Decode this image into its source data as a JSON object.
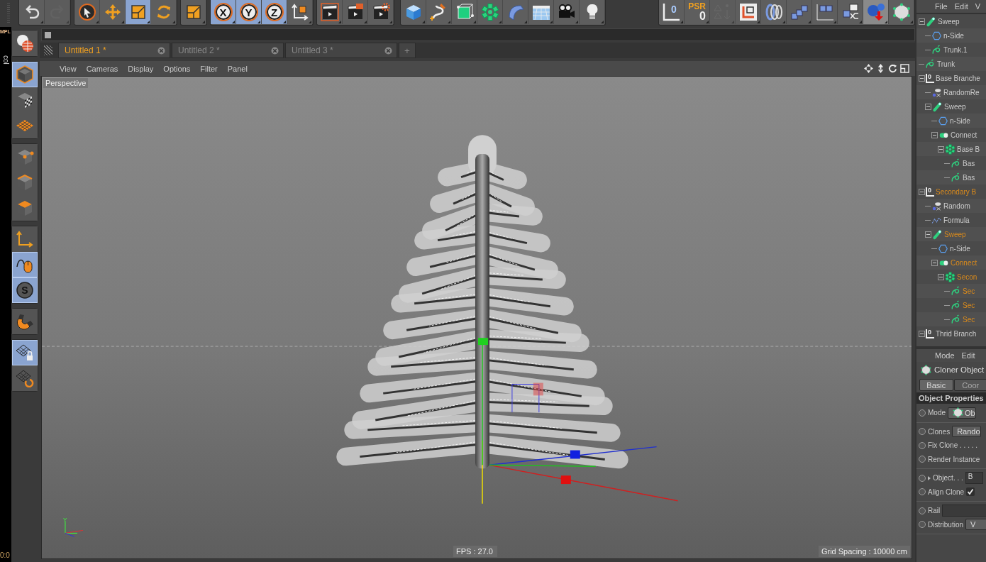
{
  "toolbar": {
    "groups": [
      {
        "buttons": [
          {
            "kind": "undo",
            "selected": false,
            "disabled": false
          },
          {
            "kind": "redo",
            "selected": false,
            "disabled": true
          }
        ]
      },
      {
        "buttons": [
          {
            "kind": "select",
            "selected": false,
            "disabled": false
          },
          {
            "kind": "move",
            "selected": false,
            "disabled": false
          },
          {
            "kind": "scale",
            "selected": true,
            "disabled": false
          },
          {
            "kind": "rotate",
            "selected": false,
            "disabled": false
          }
        ]
      },
      {
        "buttons": [
          {
            "kind": "scale",
            "selected": false,
            "disabled": false
          }
        ]
      },
      {
        "buttons": [
          {
            "kind": "axis-lock",
            "label": "X",
            "selected": true,
            "disabled": false
          },
          {
            "kind": "axis-lock",
            "label": "Y",
            "selected": true,
            "disabled": false
          },
          {
            "kind": "axis-lock",
            "label": "Z",
            "selected": true,
            "disabled": false
          },
          {
            "kind": "coords",
            "selected": false,
            "disabled": false
          }
        ]
      },
      {
        "buttons": [
          {
            "kind": "render-view",
            "selected": false,
            "disabled": false
          },
          {
            "kind": "render-picture",
            "selected": false,
            "disabled": false
          },
          {
            "kind": "render-settings",
            "selected": false,
            "disabled": false
          }
        ]
      },
      {
        "buttons": [
          {
            "kind": "cube",
            "selected": false,
            "disabled": false
          },
          {
            "kind": "pen",
            "selected": false,
            "disabled": false
          },
          {
            "kind": "subdivision",
            "selected": false,
            "disabled": false
          },
          {
            "kind": "cloner",
            "selected": false,
            "disabled": false
          },
          {
            "kind": "deformer",
            "selected": false,
            "disabled": false
          },
          {
            "kind": "floor",
            "selected": false,
            "disabled": false
          },
          {
            "kind": "camera",
            "selected": false,
            "disabled": false
          },
          {
            "kind": "light",
            "selected": false,
            "disabled": false
          }
        ]
      },
      {
        "buttons": [
          {
            "kind": "null",
            "label": "0",
            "selected": false,
            "disabled": false
          },
          {
            "kind": "psr",
            "label": "PSR",
            "value": "0",
            "selected": false,
            "disabled": false
          },
          {
            "kind": "triangles",
            "selected": false,
            "disabled": true
          },
          {
            "kind": "frame",
            "selected": false,
            "disabled": false
          },
          {
            "kind": "rings",
            "selected": false,
            "disabled": false
          },
          {
            "kind": "stairs",
            "selected": false,
            "disabled": false
          },
          {
            "kind": "graph",
            "selected": false,
            "disabled": false
          },
          {
            "kind": "shuffle",
            "selected": false,
            "disabled": false
          },
          {
            "kind": "spheres",
            "selected": true,
            "disabled": false
          },
          {
            "kind": "poly",
            "selected": false,
            "disabled": false
          }
        ]
      }
    ]
  },
  "side_fragments": [
    {
      "text": "MPL"
    },
    {
      "text": "col"
    },
    {
      "text": "0:0"
    }
  ],
  "left_toolbar": {
    "groups": [
      {
        "buttons": [
          {
            "kind": "globe",
            "selected": false
          }
        ]
      },
      {
        "buttons": [
          {
            "kind": "model",
            "selected": true
          },
          {
            "kind": "texture",
            "selected": false
          },
          {
            "kind": "workplane",
            "selected": false
          }
        ]
      },
      {
        "buttons": [
          {
            "kind": "points",
            "selected": false
          },
          {
            "kind": "edges",
            "selected": false
          },
          {
            "kind": "polygons",
            "selected": false
          }
        ]
      },
      {
        "buttons": [
          {
            "kind": "axis",
            "selected": false
          },
          {
            "kind": "tweak",
            "selected": true
          },
          {
            "kind": "snap",
            "label": "S",
            "selected": true
          }
        ]
      },
      {
        "buttons": [
          {
            "kind": "magnet",
            "selected": false
          }
        ]
      },
      {
        "buttons": [
          {
            "kind": "lock-grid",
            "selected": true
          },
          {
            "kind": "grid-rotate",
            "selected": false
          }
        ]
      }
    ]
  },
  "tabs": [
    {
      "label": "Untitled 1 *",
      "selected": true
    },
    {
      "label": "Untitled 2 *",
      "selected": false
    },
    {
      "label": "Untitled 3 *",
      "selected": false
    }
  ],
  "new_tab": "+",
  "viewport": {
    "menu": [
      "View",
      "Cameras",
      "Display",
      "Options",
      "Filter",
      "Panel"
    ],
    "label": "Perspective",
    "axis_label": "Y",
    "fps": "FPS : 27.0",
    "grid_spacing": "Grid Spacing : 10000 cm"
  },
  "object_manager": {
    "menu": [
      "File",
      "Edit",
      "V"
    ],
    "tree": [
      {
        "name": "Sweep",
        "kind": "sweep",
        "selected": false,
        "expanded": true,
        "children": [
          {
            "name": "n-Side",
            "kind": "nside",
            "selected": false
          },
          {
            "name": "Trunk.1",
            "kind": "spline",
            "selected": false
          }
        ]
      },
      {
        "name": "Trunk",
        "kind": "spline",
        "selected": false
      },
      {
        "name": "Base Branche",
        "kind": "null",
        "badge": "0",
        "selected": false,
        "expanded": true,
        "children": [
          {
            "name": "RandomRe",
            "kind": "random",
            "selected": false
          },
          {
            "name": "Sweep",
            "kind": "sweep",
            "selected": false,
            "expanded": true,
            "children": [
              {
                "name": "n-Side",
                "kind": "nside",
                "selected": false
              },
              {
                "name": "Connect",
                "kind": "connect",
                "selected": false,
                "expanded": true,
                "children": [
                  {
                    "name": "Base B",
                    "kind": "cloner",
                    "selected": false,
                    "expanded": true,
                    "children": [
                      {
                        "name": "Bas",
                        "kind": "spline",
                        "selected": false
                      },
                      {
                        "name": "Bas",
                        "kind": "spline",
                        "selected": false
                      }
                    ]
                  }
                ]
              }
            ]
          }
        ]
      },
      {
        "name": "Secondary B",
        "kind": "null",
        "badge": "0",
        "selected": true,
        "expanded": true,
        "children": [
          {
            "name": "Random",
            "kind": "random",
            "selected": false
          },
          {
            "name": "Formula",
            "kind": "formula",
            "selected": false
          },
          {
            "name": "Sweep",
            "kind": "sweep",
            "selected": true,
            "expanded": true,
            "children": [
              {
                "name": "n-Side",
                "kind": "nside",
                "selected": false
              },
              {
                "name": "Connect",
                "kind": "connect",
                "selected": true,
                "expanded": true,
                "children": [
                  {
                    "name": "Secon",
                    "kind": "cloner",
                    "selected": true,
                    "expanded": true,
                    "children": [
                      {
                        "name": "Sec",
                        "kind": "spline",
                        "selected": true
                      },
                      {
                        "name": "Sec",
                        "kind": "spline",
                        "selected": true
                      },
                      {
                        "name": "Sec",
                        "kind": "spline",
                        "selected": true
                      }
                    ]
                  }
                ]
              }
            ]
          }
        ]
      },
      {
        "name": "Thrid Branch",
        "kind": "null",
        "badge": "0",
        "selected": false,
        "expanded": true
      }
    ]
  },
  "attributes": {
    "menu": [
      "Mode",
      "Edit"
    ],
    "title": "Cloner Object",
    "tabs": [
      {
        "label": "Basic",
        "selected": true
      },
      {
        "label": "Coor",
        "selected": false
      }
    ],
    "section": "Object Properties",
    "groups": [
      [
        {
          "label": "Mode",
          "kind": "icon-dropdown",
          "value": "Ob",
          "keyframed": false
        }
      ],
      [
        {
          "label": "Clones",
          "kind": "dropdown",
          "value": "Rando",
          "keyframed": false
        },
        {
          "label": "Fix Clone . . . . .",
          "kind": "plain",
          "keyframed": false
        },
        {
          "label": "Render Instance",
          "kind": "plain",
          "keyframed": false
        }
      ],
      [
        {
          "label": "Object. . .",
          "kind": "link",
          "value": "B",
          "keyframed": false
        },
        {
          "label": "Align Clone",
          "kind": "checkbox",
          "checked": true,
          "keyframed": false
        }
      ],
      [
        {
          "label": "Rail",
          "kind": "field",
          "keyframed": false
        },
        {
          "label": "Distribution",
          "kind": "dropdown",
          "value": "V",
          "keyframed": false
        }
      ]
    ]
  }
}
